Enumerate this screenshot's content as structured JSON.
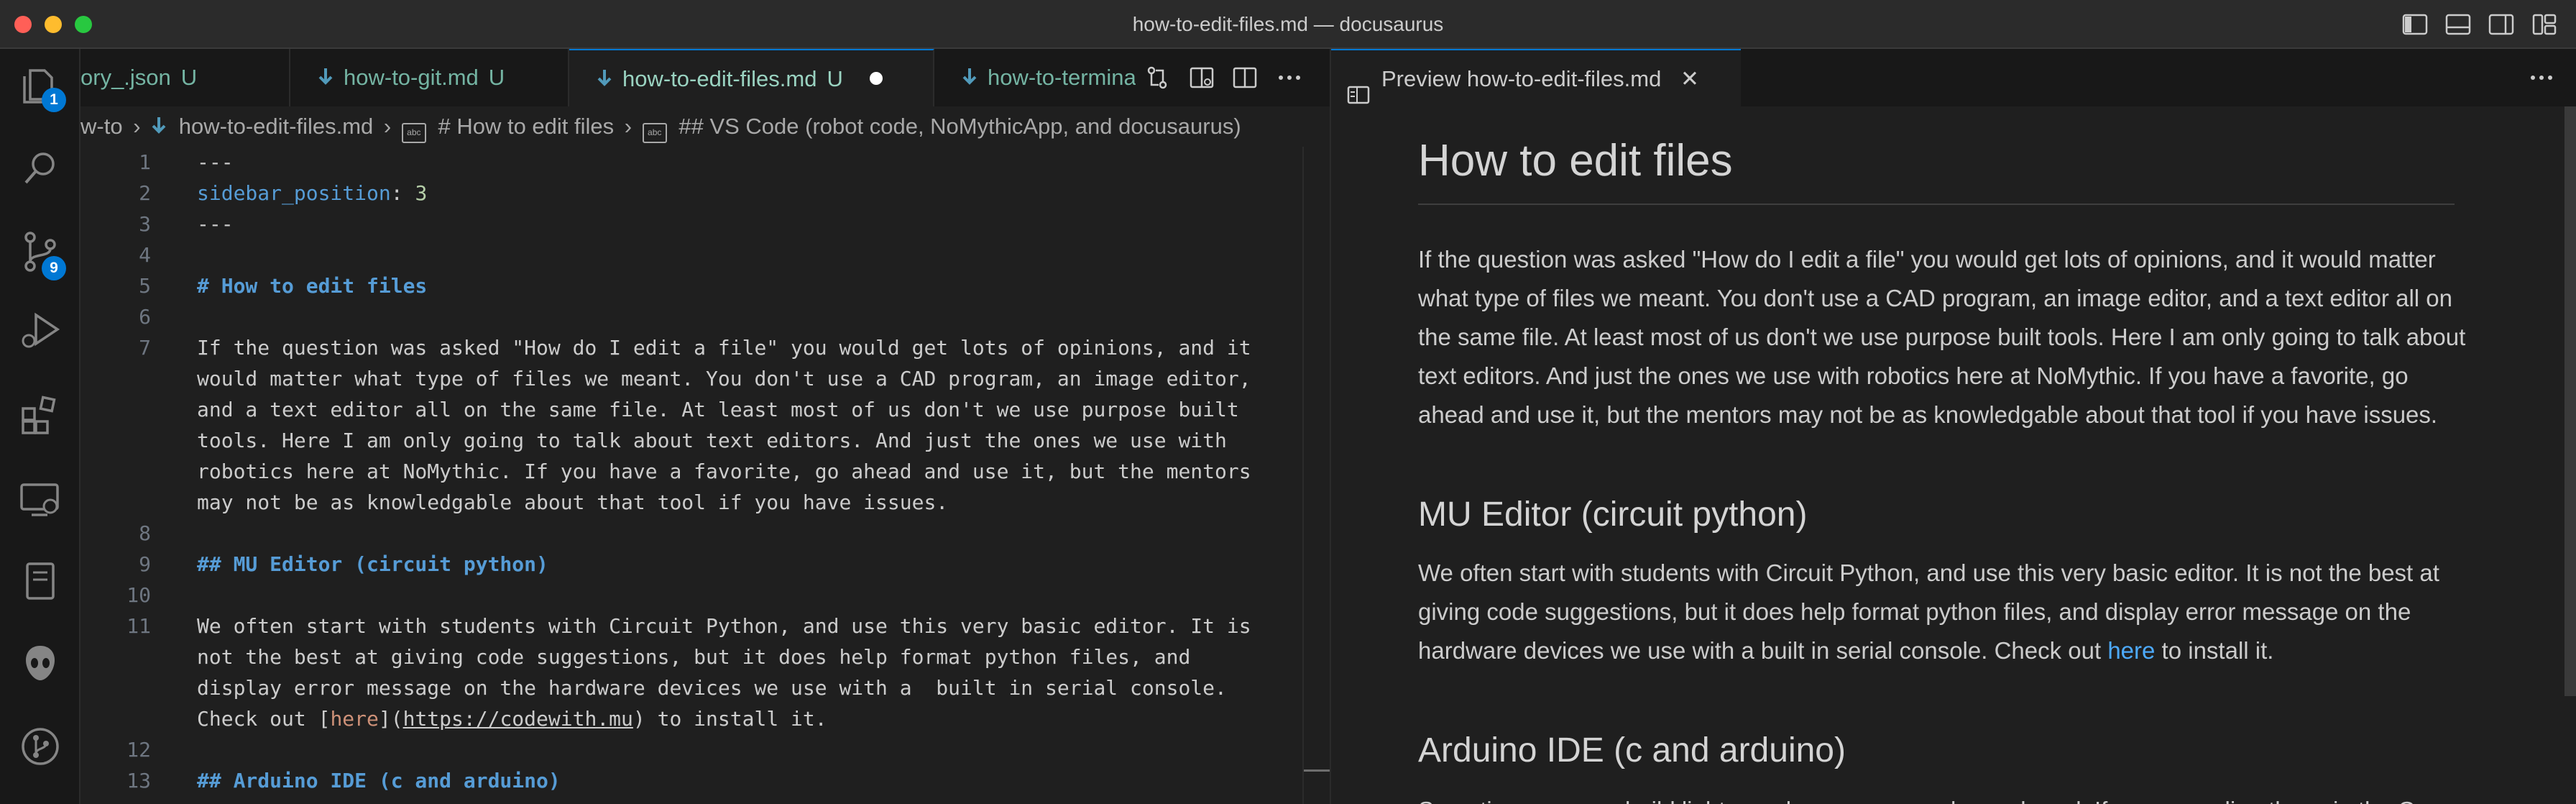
{
  "window": {
    "title": "how-to-edit-files.md — docusaurus"
  },
  "colors": {
    "accent": "#0078d4",
    "heading": "#569cd6",
    "link": "#4daafc",
    "untracked": "#74b4a3"
  },
  "activity_bar": {
    "items": [
      {
        "name": "explorer-icon",
        "badge": "1"
      },
      {
        "name": "search-icon"
      },
      {
        "name": "source-control-icon",
        "badge": "9"
      },
      {
        "name": "run-debug-icon"
      },
      {
        "name": "extensions-icon"
      },
      {
        "name": "remote-explorer-icon"
      },
      {
        "name": "notebook-icon"
      },
      {
        "name": "alien-icon"
      },
      {
        "name": "git-graph-icon"
      }
    ]
  },
  "editor_tabs": [
    {
      "label": "ory_.json",
      "status": "U"
    },
    {
      "label": "how-to-git.md",
      "status": "U"
    },
    {
      "label": "how-to-edit-files.md",
      "status": "U",
      "active": true
    },
    {
      "label": "how-to-terminal.md",
      "status": ""
    }
  ],
  "breadcrumb": {
    "folder": "w-to",
    "file": "how-to-edit-files.md",
    "h1": "# How to edit files",
    "h2": "## VS Code (robot code, NoMythicApp, and docusaurus)"
  },
  "code_lines": [
    {
      "n": "1",
      "text": "---"
    },
    {
      "n": "2",
      "key": "sidebar_position",
      "sep": ": ",
      "value": "3"
    },
    {
      "n": "3",
      "text": "---"
    },
    {
      "n": "4",
      "text": ""
    },
    {
      "n": "5",
      "heading": "# How to edit files"
    },
    {
      "n": "6",
      "text": ""
    },
    {
      "n": "7",
      "text": "If the question was asked \"How do I edit a file\" you would get lots of opinions, and it"
    },
    {
      "n": "",
      "text": "would matter what type of files we meant. You don't use a CAD program, an image editor,"
    },
    {
      "n": "",
      "text": "and a text editor all on the same file. At least most of us don't we use purpose built"
    },
    {
      "n": "",
      "text": "tools. Here I am only going to talk about text editors. And just the ones we use with"
    },
    {
      "n": "",
      "text": "robotics here at NoMythic. If you have a favorite, go ahead and use it, but the mentors"
    },
    {
      "n": "",
      "text": "may not be as knowledgable about that tool if you have issues."
    },
    {
      "n": "8",
      "text": ""
    },
    {
      "n": "9",
      "heading": "## MU Editor (circuit python)"
    },
    {
      "n": "10",
      "text": ""
    },
    {
      "n": "11",
      "text": "We often start with students with Circuit Python, and use this very basic editor. It is"
    },
    {
      "n": "",
      "text": "not the best at giving code suggestions, but it does help format python files, and"
    },
    {
      "n": "",
      "text": "display error message on the hardware devices we use with a  built in serial console."
    },
    {
      "n": "",
      "prefix": "Check out [",
      "linktext": "here",
      "mid": "](",
      "url": "https://codewith.mu",
      "suffix": ") to install it."
    },
    {
      "n": "12",
      "text": ""
    },
    {
      "n": "13",
      "heading": "## Arduino IDE (c and arduino)"
    }
  ],
  "preview": {
    "tab_label": "Preview how-to-edit-files.md",
    "title": "How to edit files",
    "para1": "If the question was asked \"How do I edit a file\" you would get lots of opinions, and it would matter what type of files we meant. You don't use a CAD program, an image editor, and a text editor all on the same file. At least most of us don't we use purpose built tools. Here I am only going to talk about text editors. And just the ones we use with robotics here at NoMythic. If you have a favorite, go ahead and use it, but the mentors may not be as knowledgable about that tool if you have issues.",
    "h2_mu": "MU Editor (circuit python)",
    "para2_before": "We often start with students with Circuit Python, and use this very basic editor. It is not the best at giving code suggestions, but it does help format python files, and display error message on the hardware devices we use with a built in serial console. Check out ",
    "para2_link": "here",
    "para2_after": " to install it.",
    "h2_arduino": "Arduino IDE (c and arduino)",
    "para3_partial": "Sometimes we can build lighter code, so we use a lesser board. If we are coding those in the C"
  }
}
